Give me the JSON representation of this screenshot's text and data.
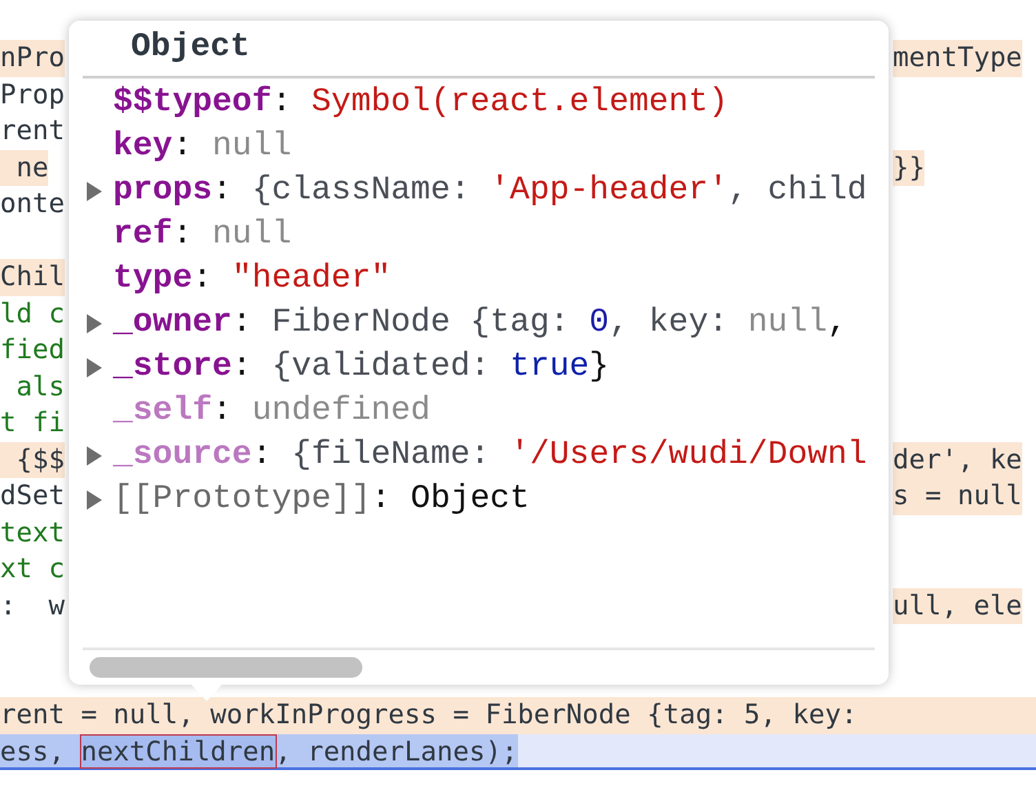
{
  "code_lines": [
    {
      "kind": "code",
      "left": {
        "text": "nPro",
        "highlighted": true
      },
      "right": {
        "text": "mentType",
        "highlighted": true
      }
    },
    {
      "kind": "code",
      "left": {
        "text": "Prop",
        "highlighted": false
      }
    },
    {
      "kind": "code",
      "left": {
        "text": "rent",
        "highlighted": false
      }
    },
    {
      "kind": "code",
      "left": {
        "text": " ne",
        "highlighted": true
      },
      "right": {
        "text": "}}",
        "highlighted": true
      }
    },
    {
      "kind": "code",
      "left": {
        "text": "onte",
        "highlighted": false
      }
    },
    {
      "kind": "blank"
    },
    {
      "kind": "code",
      "left": {
        "text": "Chil",
        "highlighted": true
      }
    },
    {
      "kind": "comment",
      "left": {
        "text": "ld c",
        "highlighted": false
      }
    },
    {
      "kind": "comment",
      "left": {
        "text": "fied",
        "highlighted": false
      }
    },
    {
      "kind": "comment",
      "left": {
        "text": " als",
        "highlighted": false
      }
    },
    {
      "kind": "comment",
      "left": {
        "text": "t fi",
        "highlighted": false
      }
    },
    {
      "kind": "code",
      "left": {
        "text": " {$$",
        "highlighted": true
      },
      "right": {
        "text": "der', ke",
        "highlighted": true
      }
    },
    {
      "kind": "code",
      "left": {
        "text": "dSet",
        "highlighted": false
      },
      "right": {
        "text": "s = null",
        "highlighted": true
      }
    },
    {
      "kind": "comment",
      "left": {
        "text": "text",
        "highlighted": false
      }
    },
    {
      "kind": "comment",
      "left": {
        "text": "xt c",
        "highlighted": false
      }
    },
    {
      "kind": "code",
      "left": {
        "text": ":  w",
        "highlighted": false
      },
      "right": {
        "text": "ull, ele",
        "highlighted": true
      }
    },
    {
      "kind": "blank"
    },
    {
      "kind": "blank"
    },
    {
      "kind": "paused",
      "segments": [
        {
          "text": "rent = null, workInProgress = FiberNode {tag: 5, key:",
          "selected": false
        }
      ]
    },
    {
      "kind": "current",
      "segments": [
        {
          "text": "ess, ",
          "selected": false
        },
        {
          "text": "nextChildren",
          "selected": true
        },
        {
          "text": ", renderLanes);",
          "selected": false
        }
      ]
    }
  ],
  "popover": {
    "title": "Object",
    "properties": [
      {
        "key": "$$typeof",
        "kind": "own",
        "expandable": false,
        "value": [
          {
            "text": ": ",
            "kind": "punct"
          },
          {
            "text": "Symbol(react.element)",
            "kind": "string"
          }
        ]
      },
      {
        "key": "key",
        "kind": "own",
        "expandable": false,
        "value": [
          {
            "text": ": ",
            "kind": "punct"
          },
          {
            "text": "null",
            "kind": "null"
          }
        ]
      },
      {
        "key": "props",
        "kind": "own",
        "expandable": true,
        "value": [
          {
            "text": ": ",
            "kind": "punct"
          },
          {
            "text": "{className: ",
            "kind": "plain"
          },
          {
            "text": "'App-header'",
            "kind": "string"
          },
          {
            "text": ", child",
            "kind": "plain"
          }
        ]
      },
      {
        "key": "ref",
        "kind": "own",
        "expandable": false,
        "value": [
          {
            "text": ": ",
            "kind": "punct"
          },
          {
            "text": "null",
            "kind": "null"
          }
        ]
      },
      {
        "key": "type",
        "kind": "own",
        "expandable": false,
        "value": [
          {
            "text": ": ",
            "kind": "punct"
          },
          {
            "text": "\"header\"",
            "kind": "string"
          }
        ]
      },
      {
        "key": "_owner",
        "kind": "own",
        "expandable": true,
        "value": [
          {
            "text": ": ",
            "kind": "punct"
          },
          {
            "text": "FiberNode {tag: ",
            "kind": "plain"
          },
          {
            "text": "0",
            "kind": "number"
          },
          {
            "text": ", key: ",
            "kind": "plain"
          },
          {
            "text": "null",
            "kind": "null"
          },
          {
            "text": ",",
            "kind": "punct"
          }
        ]
      },
      {
        "key": "_store",
        "kind": "own",
        "expandable": true,
        "value": [
          {
            "text": ": ",
            "kind": "punct"
          },
          {
            "text": "{validated: ",
            "kind": "plain"
          },
          {
            "text": "true",
            "kind": "bool"
          },
          {
            "text": "}",
            "kind": "punct"
          }
        ]
      },
      {
        "key": "_self",
        "kind": "nonenumerable",
        "expandable": false,
        "value": [
          {
            "text": ": ",
            "kind": "punct"
          },
          {
            "text": "undefined",
            "kind": "null"
          }
        ]
      },
      {
        "key": "_source",
        "kind": "nonenumerable",
        "expandable": true,
        "value": [
          {
            "text": ": ",
            "kind": "punct"
          },
          {
            "text": "{fileName: ",
            "kind": "plain"
          },
          {
            "text": "'/Users/wudi/Downl",
            "kind": "string"
          }
        ]
      },
      {
        "key": "[[Prototype]]",
        "kind": "internal",
        "expandable": true,
        "value": [
          {
            "text": ": ",
            "kind": "punct"
          },
          {
            "text": "Object",
            "kind": "punct"
          }
        ]
      }
    ]
  }
}
